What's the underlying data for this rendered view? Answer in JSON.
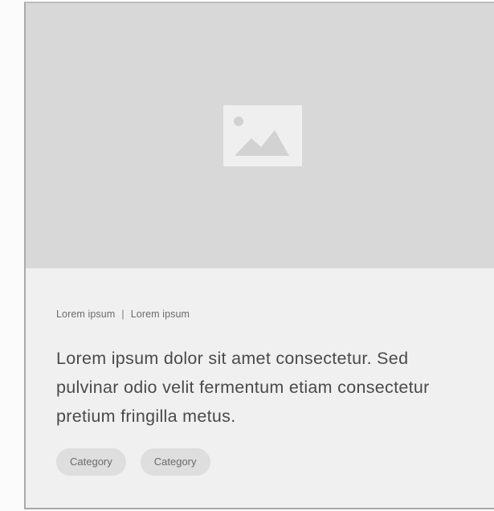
{
  "card": {
    "meta": {
      "left": "Lorem ipsum",
      "separator": "|",
      "right": "Lorem ipsum"
    },
    "title": "Lorem ipsum dolor sit amet consectetur. Sed pulvinar odio velit fermentum etiam consectetur pretium fringilla metus.",
    "chips": [
      "Category",
      "Category"
    ],
    "image_icon": "image-placeholder-icon"
  },
  "colors": {
    "image_bg": "#d8d8d8",
    "card_bg": "#f0f0f0",
    "chip_bg": "#dedede",
    "title_text": "#4a4a4a"
  }
}
